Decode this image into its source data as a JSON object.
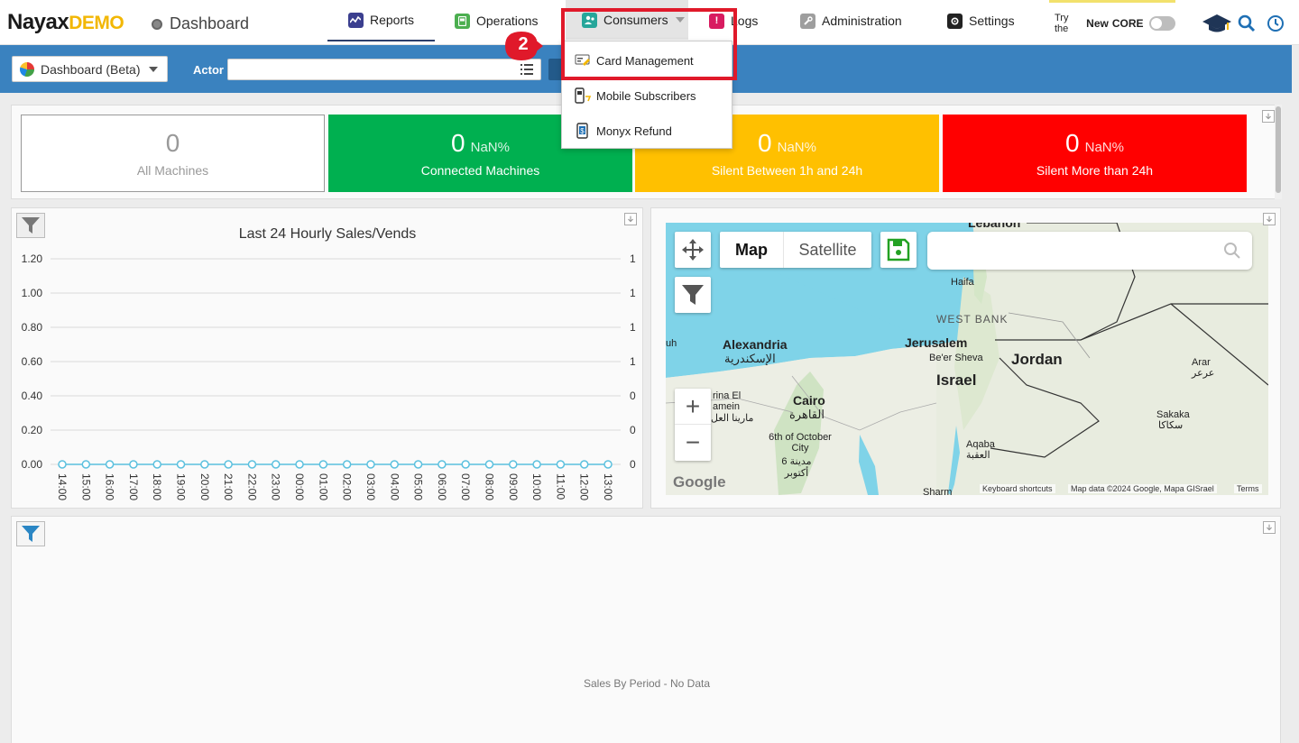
{
  "header": {
    "logo_main": "Nayax",
    "logo_demo": "DEMO",
    "page_title": "Dashboard",
    "nav": {
      "reports": "Reports",
      "operations": "Operations",
      "consumers": "Consumers",
      "logs": "Logs",
      "administration": "Administration",
      "settings": "Settings"
    },
    "try_prefix": "Try the",
    "try_new": "New",
    "try_core": "CORE"
  },
  "toolbar": {
    "dashboard_select": "Dashboard (Beta)",
    "actor_label": "Actor",
    "actor_value": ""
  },
  "step_number": "2",
  "consumers_menu": {
    "items": [
      {
        "label": "Card Management",
        "icon": "card-icon"
      },
      {
        "label": "Mobile Subscribers",
        "icon": "mobile-icon"
      },
      {
        "label": "Monyx Refund",
        "icon": "refund-icon"
      }
    ]
  },
  "kpis": {
    "all": {
      "value": "0",
      "label": "All Machines"
    },
    "connected": {
      "value": "0",
      "pct": "NaN%",
      "label": "Connected Machines",
      "color": "#00b050"
    },
    "silent_1_24": {
      "value": "0",
      "pct": "NaN%",
      "label": "Silent Between 1h and 24h",
      "color": "#ffc000"
    },
    "silent_24": {
      "value": "0",
      "pct": "NaN%",
      "label": "Silent More than 24h",
      "color": "#ff0000"
    }
  },
  "chart_data": {
    "type": "line",
    "title": "Last 24 Hourly Sales/Vends",
    "x": [
      "14:00",
      "15:00",
      "16:00",
      "17:00",
      "18:00",
      "19:00",
      "20:00",
      "21:00",
      "22:00",
      "23:00",
      "00:00",
      "01:00",
      "02:00",
      "03:00",
      "04:00",
      "05:00",
      "06:00",
      "07:00",
      "08:00",
      "09:00",
      "10:00",
      "11:00",
      "12:00",
      "13:00"
    ],
    "series": [
      {
        "values": [
          0,
          0,
          0,
          0,
          0,
          0,
          0,
          0,
          0,
          0,
          0,
          0,
          0,
          0,
          0,
          0,
          0,
          0,
          0,
          0,
          0,
          0,
          0,
          0
        ]
      }
    ],
    "y_ticks_left": [
      "1.20",
      "1.00",
      "0.80",
      "0.60",
      "0.40",
      "0.20",
      "0.00"
    ],
    "y_ticks_right": [
      "1",
      "1",
      "1",
      "1",
      "0",
      "0",
      "0"
    ],
    "ylim": [
      0,
      1.2
    ],
    "grid": true,
    "color": "#5bc0de"
  },
  "map": {
    "type_map": "Map",
    "type_satellite": "Satellite",
    "labels": {
      "lebanon": "Lebanon",
      "haifa": "Haifa",
      "west_bank": "WEST BANK",
      "alexandria": "Alexandria",
      "alexandria_ar": "الإسكندرية",
      "jerusalem": "Jerusalem",
      "beer_sheva": "Be'er Sheva",
      "israel": "Israel",
      "jordan": "Jordan",
      "arar": "Arar",
      "arar_ar": "عرعر",
      "cairo": "Cairo",
      "cairo_ar": "القاهرة",
      "el_alamein": "rina El amein",
      "el_alamein_ar": "مارينا العل",
      "october": "6th of October City",
      "october_ar": "مدينة 6 أكتوبر",
      "sakaka": "Sakaka",
      "sakaka_ar": "سكاكا",
      "aqaba": "Aqaba",
      "aqaba_ar": "العقبة",
      "sharm": "Sharm",
      "uh": "uh"
    },
    "footer": {
      "shortcuts": "Keyboard shortcuts",
      "mapdata": "Map data ©2024 Google, Mapa GISrael",
      "terms": "Terms",
      "google": "Google"
    }
  },
  "sales_period": {
    "empty_text": "Sales By Period - No Data"
  }
}
